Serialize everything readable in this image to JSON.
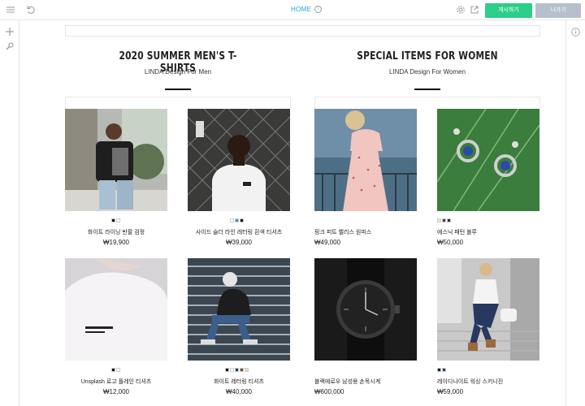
{
  "topbar": {
    "home_label": "HOME",
    "publish_label": "게시하기",
    "exit_label": "나가기"
  },
  "sections": [
    {
      "title": "2020 SUMMER MEN'S T-SHIRTS",
      "subtitle": "LINDA Design For Men"
    },
    {
      "title": "SPECIAL ITEMS FOR WOMEN",
      "subtitle": "LINDA Design For Women"
    }
  ],
  "products": [
    {
      "name": "화이트 라이닝 반팔 검정",
      "price": "₩19,900",
      "swatches": [
        "#111111",
        "#ffffff"
      ]
    },
    {
      "name": "사이드 슬더 라인 레터링 흰색 티셔츠",
      "price": "₩39,000",
      "swatches": [
        "#ffffff",
        "#1a9fd6",
        "#111111"
      ]
    },
    {
      "name": "핑크 피트 벨리스 원피스",
      "price": "₩49,000",
      "swatches": []
    },
    {
      "name": "에스닉 패턴 블루",
      "price": "₩50,000",
      "swatches": [
        "#efe6d8",
        "#3c3a6e",
        "#2a2a4a"
      ]
    },
    {
      "name": "Unsplash 로고 플레인 티셔츠",
      "price": "₩12,000",
      "swatches": [
        "#111111",
        "#ffffff"
      ]
    },
    {
      "name": "화이트 레터링 티셔츠",
      "price": "₩40,000",
      "swatches": [
        "#111111",
        "#ffffff",
        "#1a3c6e",
        "#6b4a2a",
        "#e8dcc6"
      ]
    },
    {
      "name": "블랙에로우 남성용 손목시계",
      "price": "₩600,000",
      "swatches": []
    },
    {
      "name": "레이디나이트 워싱 스키니진",
      "price": "₩59,000",
      "swatches": [
        "#111111",
        "#1a3c6e"
      ]
    }
  ]
}
